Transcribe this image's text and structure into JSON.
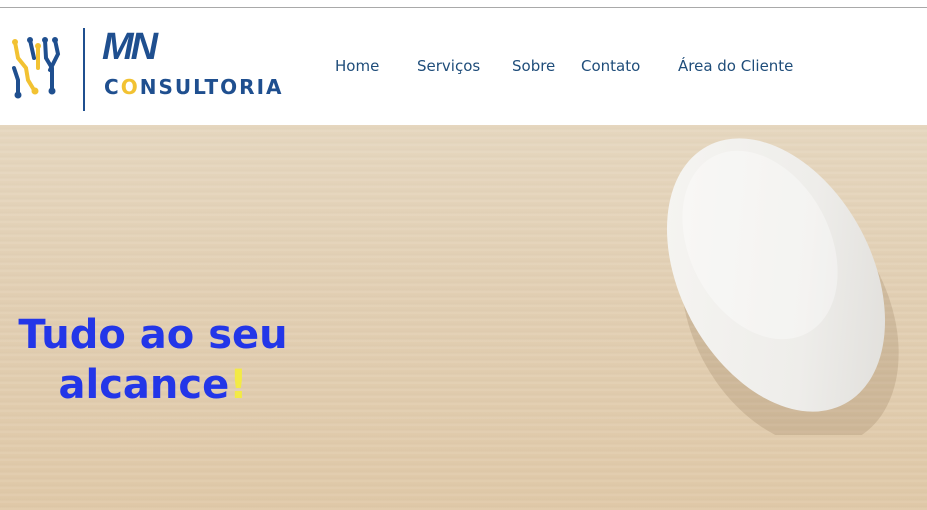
{
  "header": {
    "logo": {
      "mark": "MN",
      "sub_pre": "C",
      "sub_accent": "O",
      "sub_post": "NSULTORIA"
    },
    "nav": [
      {
        "label": "Home"
      },
      {
        "label": "Serviços"
      },
      {
        "label": "Sobre"
      },
      {
        "label": "Contato"
      },
      {
        "label": "Área do Cliente"
      }
    ]
  },
  "hero": {
    "headline_line1": "Tudo ao seu",
    "headline_line2": "alcance",
    "headline_punct": "!"
  },
  "colors": {
    "brand_blue": "#1f4f8f",
    "brand_yellow": "#f2c232",
    "headline_blue": "#2336e8",
    "exclaim_yellow": "#f3ea45",
    "nav_text": "#1f4d7a",
    "wood": "#e2cfb3"
  }
}
